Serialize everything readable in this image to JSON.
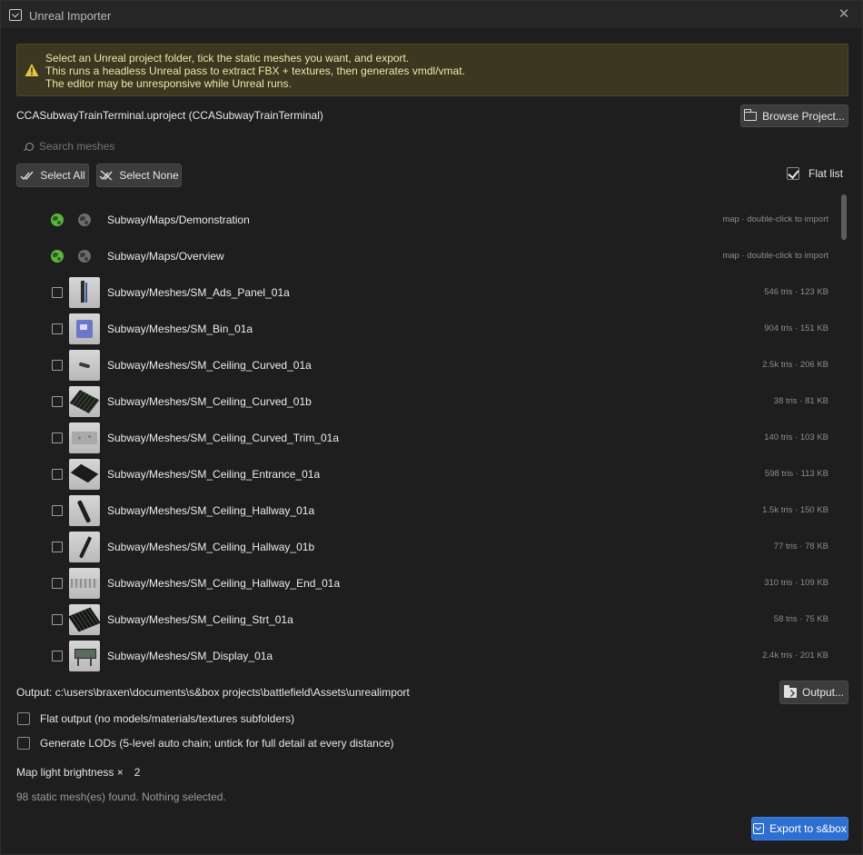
{
  "window": {
    "title": "Unreal Importer",
    "close_icon": "close-icon"
  },
  "warning": {
    "icon": "warning-icon",
    "lines": [
      "Select an Unreal project folder, tick the static meshes you want, and export.",
      "This runs a headless Unreal pass to extract FBX + textures, then generates vmdl/vmat.",
      "The editor may be unresponsive while Unreal runs."
    ]
  },
  "project": {
    "label": "CCASubwayTrainTerminal.uproject  (CCASubwayTrainTerminal)",
    "browse_label": "Browse Project..."
  },
  "search": {
    "placeholder": "Search meshes",
    "value": ""
  },
  "selection": {
    "select_all_label": "Select All",
    "select_none_label": "Select None"
  },
  "flat_list": {
    "label": "Flat list",
    "checked": true
  },
  "items": [
    {
      "kind": "map",
      "name": "Subway/Maps/Demonstration",
      "info": "map · double-click to import"
    },
    {
      "kind": "map",
      "name": "Subway/Maps/Overview",
      "info": "map · double-click to import"
    },
    {
      "kind": "mesh",
      "thumb": "panel",
      "name": "Subway/Meshes/SM_Ads_Panel_01a",
      "info": "546 tris · 123 KB"
    },
    {
      "kind": "mesh",
      "thumb": "bin",
      "name": "Subway/Meshes/SM_Bin_01a",
      "info": "904 tris · 151 KB"
    },
    {
      "kind": "mesh",
      "thumb": "curve",
      "name": "Subway/Meshes/SM_Ceiling_Curved_01a",
      "info": "2.5k tris · 206 KB"
    },
    {
      "kind": "mesh",
      "thumb": "grid",
      "name": "Subway/Meshes/SM_Ceiling_Curved_01b",
      "info": "38 tris · 81 KB"
    },
    {
      "kind": "mesh",
      "thumb": "trim",
      "name": "Subway/Meshes/SM_Ceiling_Curved_Trim_01a",
      "info": "140 tris · 103 KB"
    },
    {
      "kind": "mesh",
      "thumb": "entrance",
      "name": "Subway/Meshes/SM_Ceiling_Entrance_01a",
      "info": "598 tris · 113 KB"
    },
    {
      "kind": "mesh",
      "thumb": "hall",
      "name": "Subway/Meshes/SM_Ceiling_Hallway_01a",
      "info": "1.5k tris · 150 KB"
    },
    {
      "kind": "mesh",
      "thumb": "hall2",
      "name": "Subway/Meshes/SM_Ceiling_Hallway_01b",
      "info": "77 tris · 78 KB"
    },
    {
      "kind": "mesh",
      "thumb": "hallend",
      "name": "Subway/Meshes/SM_Ceiling_Hallway_End_01a",
      "info": "310 tris · 109 KB"
    },
    {
      "kind": "mesh",
      "thumb": "strt",
      "name": "Subway/Meshes/SM_Ceiling_Strt_01a",
      "info": "58 tris · 75 KB"
    },
    {
      "kind": "mesh",
      "thumb": "display",
      "name": "Subway/Meshes/SM_Display_01a",
      "info": "2.4k tris · 201 KB"
    }
  ],
  "output": {
    "path_label": "Output: c:\\users\\braxen\\documents\\s&box projects\\battlefield\\Assets\\unrealimport",
    "button_label": "Output..."
  },
  "options": {
    "flat_output_label": "Flat output (no models/materials/textures subfolders)",
    "flat_output_checked": false,
    "lods_label": "Generate LODs (5-level auto chain; untick for full detail at every distance)",
    "lods_checked": false
  },
  "brightness": {
    "label": "Map light brightness ×",
    "value": "2"
  },
  "status": "98 static mesh(es) found.  Nothing selected.",
  "export": {
    "label": "Export to s&box"
  },
  "colors": {
    "accent": "#2f6fd1",
    "warning_bg": "#3b3720",
    "warning_text": "#f0e6a8",
    "map_globe": "#59b53d"
  }
}
